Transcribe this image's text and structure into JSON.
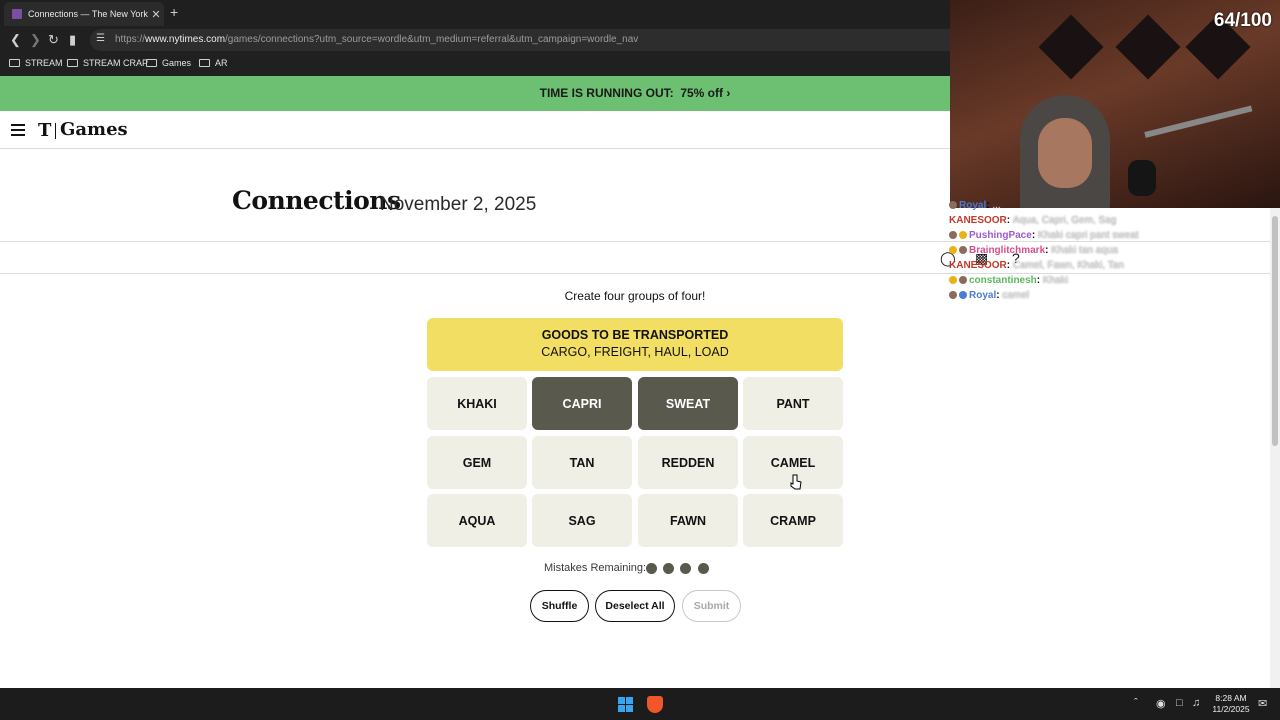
{
  "browser": {
    "tab_title": "Connections — The New York Ti",
    "tab_close": "✕",
    "new_tab": "+",
    "url_prefix": "https://",
    "url_host": "www.nytimes.com",
    "url_path": "/games/connections?utm_source=wordle&utm_medium=referral&utm_campaign=wordle_nav",
    "bookmarks": [
      "STREAM",
      "STREAM CRAP",
      "Games",
      "AR"
    ]
  },
  "promo": {
    "text": "TIME IS RUNNING OUT:",
    "sale": "75% off",
    "arrow": "›"
  },
  "header": {
    "logo_t": "T",
    "logo_games": "Games"
  },
  "page": {
    "title": "Connections",
    "date": "November 2, 2025",
    "instructions": "Create four groups of four!"
  },
  "solved_group": {
    "category": "GOODS TO BE TRANSPORTED",
    "members": "CARGO, FREIGHT, HAUL, LOAD",
    "color": "#f2de62"
  },
  "tiles": [
    {
      "word": "KHAKI",
      "selected": false
    },
    {
      "word": "CAPRI",
      "selected": true
    },
    {
      "word": "SWEAT",
      "selected": true
    },
    {
      "word": "PANT",
      "selected": false
    },
    {
      "word": "GEM",
      "selected": false
    },
    {
      "word": "TAN",
      "selected": false
    },
    {
      "word": "REDDEN",
      "selected": false
    },
    {
      "word": "CAMEL",
      "selected": false
    },
    {
      "word": "AQUA",
      "selected": false
    },
    {
      "word": "SAG",
      "selected": false
    },
    {
      "word": "FAWN",
      "selected": false
    },
    {
      "word": "CRAMP",
      "selected": false
    }
  ],
  "mistakes": {
    "label": "Mistakes Remaining:",
    "remaining": 4
  },
  "buttons": {
    "shuffle": "Shuffle",
    "deselect": "Deselect All",
    "submit": "Submit"
  },
  "stream": {
    "counter": "64/100",
    "chat": [
      {
        "user": "Royal",
        "msg": "...",
        "color": "#4a7bd6"
      },
      {
        "user": "KANESOOR",
        "msg": "Aqua, Capri, Gem, Sag",
        "color": "#c0392b"
      },
      {
        "user": "PushingPace",
        "msg": "Khaki capri pant sweat",
        "color": "#9b59d0"
      },
      {
        "user": "Brainglitchmark",
        "msg": "Khaki tan aqua",
        "color": "#d94f8a"
      },
      {
        "user": "KANESOOR",
        "msg": "Camel, Fawn, Khaki, Tan",
        "color": "#c0392b"
      },
      {
        "user": "constantinesh",
        "msg": "Khaki",
        "color": "#5cb85c"
      },
      {
        "user": "Royal",
        "msg": "camel",
        "color": "#4a7bd6"
      }
    ]
  },
  "taskbar": {
    "time": "8:28 AM",
    "date": "11/2/2025"
  }
}
